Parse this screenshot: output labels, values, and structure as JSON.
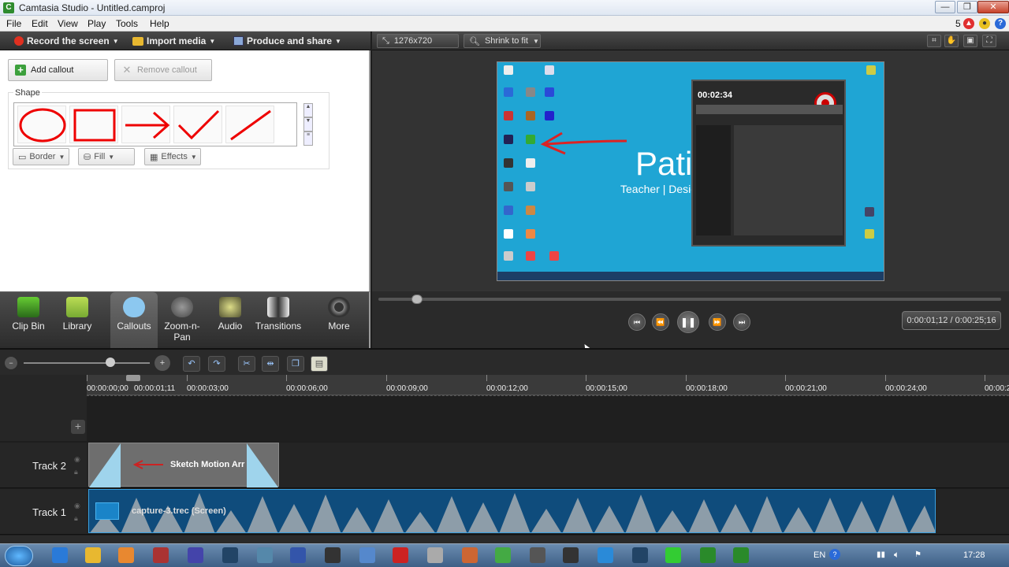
{
  "window": {
    "title": "Camtasia Studio - Untitled.camproj",
    "app_icon": "C",
    "minimize": "—",
    "maximize": "❐",
    "close": "✕"
  },
  "menu": {
    "items": [
      "File",
      "Edit",
      "View",
      "Play",
      "Tools",
      "Help"
    ],
    "notification_count": "5"
  },
  "toolbar": {
    "record": "Record the screen",
    "import": "Import media",
    "produce": "Produce and share"
  },
  "callouts": {
    "add_label": "Add callout",
    "remove_label": "Remove callout",
    "shape_label": "Shape",
    "border_label": "Border",
    "fill_label": "Fill",
    "effects_label": "Effects"
  },
  "preview": {
    "dimensions": "1276x720",
    "zoom": "Shrink to fit",
    "screen_text": "Patip",
    "screen_subtext": "Teacher | Desig",
    "recorder_time": "00:02:34"
  },
  "nav": {
    "items": [
      "Clip Bin",
      "Library",
      "Callouts",
      "Zoom-n-Pan",
      "Audio",
      "Transitions",
      "More"
    ]
  },
  "playback": {
    "time": "0:00:01;12 / 0:00:25;16",
    "progress": 0.055
  },
  "timeline": {
    "ticks": [
      "00:00:00;00",
      "00:00:03;00",
      "00:00:06;00",
      "00:00:09;00",
      "00:00:12;00",
      "00:00:15;00",
      "00:00:18;00",
      "00:00:21;00",
      "00:00:24;00",
      "00:00:2"
    ],
    "playhead": "00:00:01;11",
    "tracks": [
      {
        "label": "Track 2",
        "clip": "Sketch Motion Arr"
      },
      {
        "label": "Track 1",
        "clip": "capture-3.trec (Screen)"
      }
    ]
  },
  "taskbar": {
    "lang": "EN",
    "clock": "17:28"
  },
  "colors": {
    "accent": "#1fa5d4",
    "record": "#e03020",
    "clip_audio": "#0f4c7c"
  }
}
